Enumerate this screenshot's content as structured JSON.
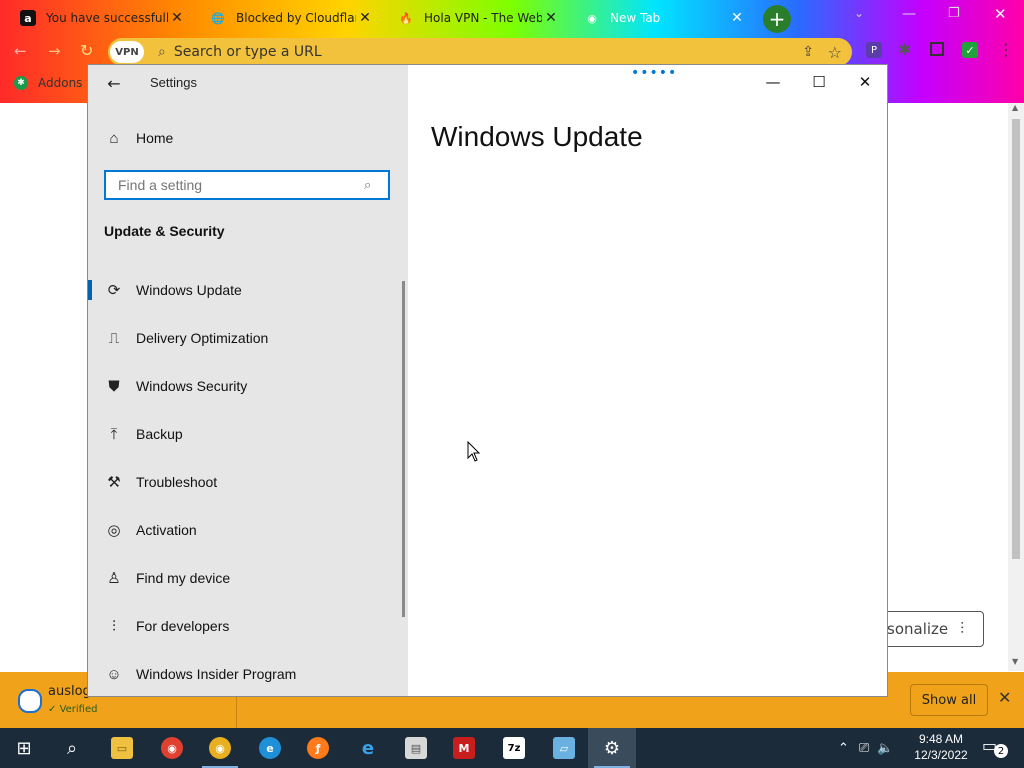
{
  "browser": {
    "tabs": [
      {
        "title": "You have successfully c",
        "favicon": "a"
      },
      {
        "title": "Blocked by Cloudflare",
        "favicon": "🌐"
      },
      {
        "title": "Hola VPN - The Websi",
        "favicon": "🔥"
      },
      {
        "title": "New Tab",
        "favicon": "◉"
      }
    ],
    "new_tab_label": "+",
    "omnibox": {
      "vpn_badge": "VPN",
      "placeholder": "Search or type a URL"
    },
    "bookmark": {
      "label": "Addons S"
    },
    "personalize_label": "sonalize"
  },
  "download_shelf": {
    "file_name": "auslog",
    "status": "Verified",
    "show_all_label": "Show all"
  },
  "settings": {
    "window_title": "Settings",
    "home_label": "Home",
    "search_placeholder": "Find a setting",
    "section_title": "Update & Security",
    "nav_items": [
      {
        "label": "Windows Update",
        "icon": "refresh-icon",
        "active": true
      },
      {
        "label": "Delivery Optimization",
        "icon": "delivery-icon"
      },
      {
        "label": "Windows Security",
        "icon": "shield-icon"
      },
      {
        "label": "Backup",
        "icon": "backup-icon"
      },
      {
        "label": "Troubleshoot",
        "icon": "wrench-icon"
      },
      {
        "label": "Activation",
        "icon": "check-circle-icon"
      },
      {
        "label": "Find my device",
        "icon": "person-location-icon"
      },
      {
        "label": "For developers",
        "icon": "developer-icon"
      },
      {
        "label": "Windows Insider Program",
        "icon": "insider-icon"
      }
    ],
    "content_title": "Windows Update"
  },
  "taskbar": {
    "clock_time": "9:48 AM",
    "clock_date": "12/3/2022",
    "notification_count": "2"
  },
  "colors": {
    "accent": "#0078d7",
    "sidebar_bg": "#e6e6e6",
    "taskbar_bg": "#1b2b3a",
    "download_shelf_bg": "#efa21a"
  }
}
